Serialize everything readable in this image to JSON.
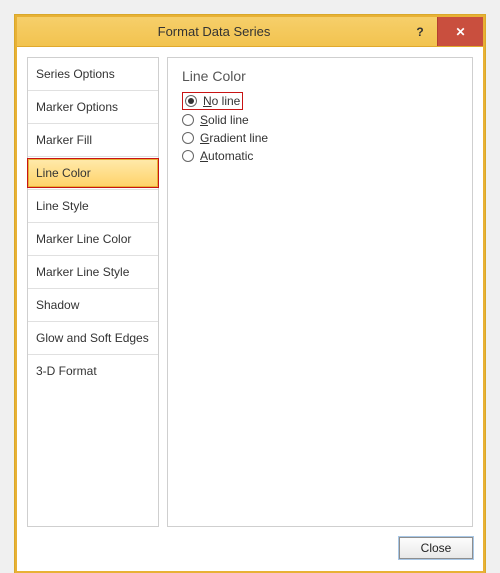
{
  "dialog": {
    "title": "Format Data Series",
    "help_symbol": "?",
    "close_symbol": "✕",
    "close_button": "Close"
  },
  "sidebar": {
    "items": [
      {
        "label": "Series Options"
      },
      {
        "label": "Marker Options"
      },
      {
        "label": "Marker Fill"
      },
      {
        "label": "Line Color",
        "selected": true
      },
      {
        "label": "Line Style"
      },
      {
        "label": "Marker Line Color"
      },
      {
        "label": "Marker Line Style"
      },
      {
        "label": "Shadow"
      },
      {
        "label": "Glow and Soft Edges"
      },
      {
        "label": "3-D Format"
      }
    ]
  },
  "panel": {
    "title": "Line Color",
    "options": [
      {
        "label": "No line",
        "selected": true,
        "highlight": true
      },
      {
        "label": "Solid line",
        "selected": false
      },
      {
        "label": "Gradient line",
        "selected": false
      },
      {
        "label": "Automatic",
        "selected": false
      }
    ]
  }
}
